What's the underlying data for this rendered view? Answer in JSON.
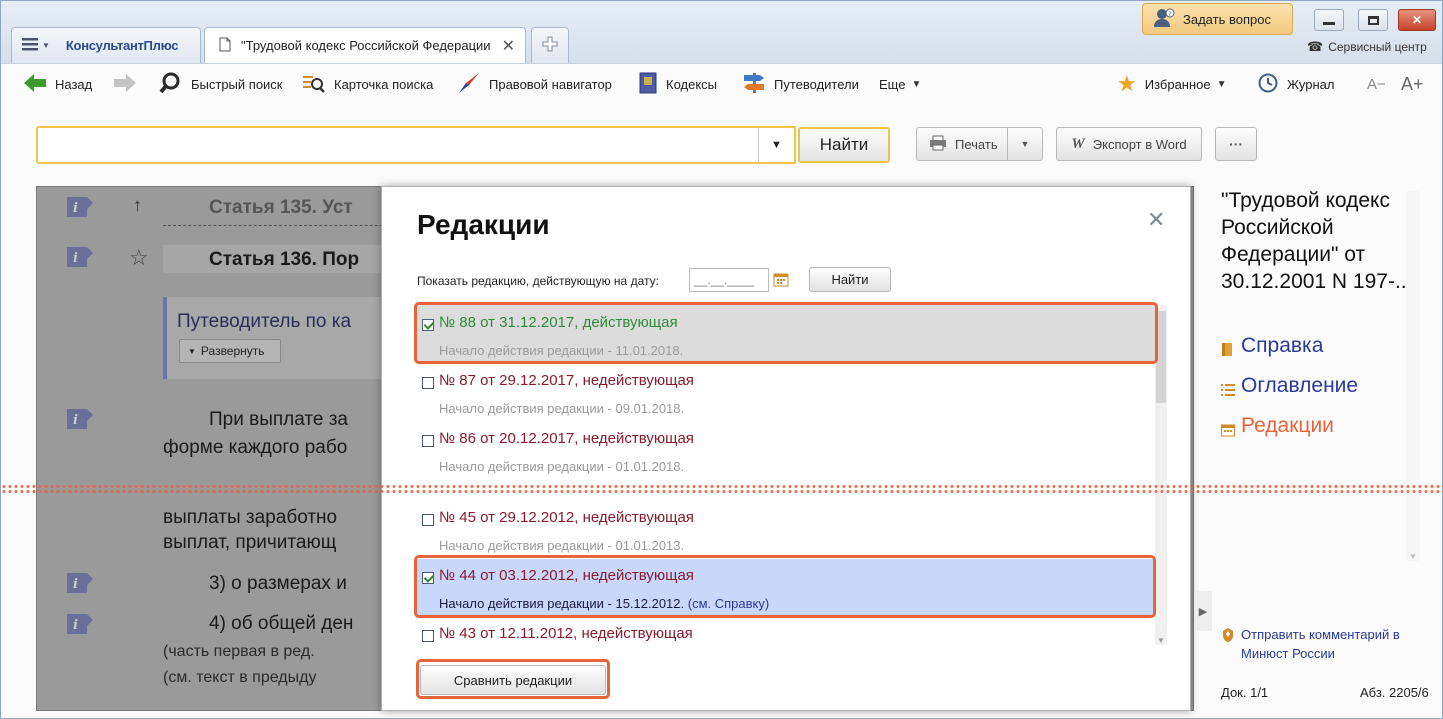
{
  "titlebar": {
    "menu_icon": "hamburger-icon",
    "app_tab_label": "КонсультантПлюс",
    "doc_tab_label": "\"Трудовой кодекс Российской Федерации",
    "ask_button": "Задать вопрос",
    "service_center": "Сервисный центр"
  },
  "toolbar": {
    "back": "Назад",
    "quick_search": "Быстрый поиск",
    "search_card": "Карточка поиска",
    "legal_navigator": "Правовой навигатор",
    "codes": "Кодексы",
    "guides": "Путеводители",
    "more": "Еще",
    "favorites": "Избранное",
    "journal": "Журнал",
    "font_smaller": "A−",
    "font_bigger": "A+"
  },
  "search": {
    "placeholder": "",
    "find_button": "Найти",
    "print_button": "Печать",
    "export_button": "Экспорт в Word",
    "more_button": "···"
  },
  "document": {
    "lines": [
      {
        "text": "Статья 135. Уст"
      },
      {
        "text": "Статья 136. Пор"
      },
      {
        "text": "Путеводитель по ка"
      },
      {
        "text": "Развернуть"
      },
      {
        "text": "При выплате за"
      },
      {
        "text": "форме каждого рабо"
      },
      {
        "text": "выплаты заработно"
      },
      {
        "text": "выплат, причитающ"
      },
      {
        "text": "3) о размерах и"
      },
      {
        "text": "4) об общей ден"
      },
      {
        "text": "(часть первая в ред."
      },
      {
        "text": "(см. текст в предыду"
      }
    ]
  },
  "dialog": {
    "title": "Редакции",
    "date_label": "Показать редакцию, действующую на дату:",
    "date_placeholder": "__.__.____",
    "find_button": "Найти",
    "compare_button": "Сравнить редакции",
    "items": [
      {
        "title": "№ 88 от 31.12.2017, действующая",
        "subtitle": "Начало действия редакции - 11.01.2018.",
        "link": "",
        "checked": true,
        "state": "current"
      },
      {
        "title": "№ 87 от 29.12.2017, недействующая",
        "subtitle": "Начало действия редакции - 09.01.2018.",
        "link": "",
        "checked": false,
        "state": "normal"
      },
      {
        "title": "№ 86 от 20.12.2017, недействующая",
        "subtitle": "Начало действия редакции - 01.01.2018.",
        "link": "",
        "checked": false,
        "state": "normal"
      },
      {
        "title": "№ 45 от 29.12.2012, недействующая",
        "subtitle": "Начало действия редакции - 01.01.2013.",
        "link": "",
        "checked": false,
        "state": "normal"
      },
      {
        "title": "№ 44 от 03.12.2012, недействующая",
        "subtitle": "Начало действия редакции - 15.12.2012.",
        "link": "(см. Справку)",
        "checked": true,
        "state": "selected"
      },
      {
        "title": "№ 43 от 12.11.2012, недействующая",
        "subtitle": "",
        "link": "",
        "checked": false,
        "state": "normal"
      }
    ]
  },
  "sidebar": {
    "doc_title": [
      "\"Трудовой кодекс",
      "Российской",
      "Федерации\" от",
      "30.12.2001 N 197-..."
    ],
    "links": [
      {
        "label": "Справка",
        "icon": "book-icon"
      },
      {
        "label": "Оглавление",
        "icon": "list-icon"
      },
      {
        "label": "Редакции",
        "icon": "calendar-icon"
      }
    ],
    "feedback": [
      "Отправить комментарий в",
      "Минюст России"
    ],
    "doc_counter": "Док. 1/1",
    "abs_counter": "Абз. 2205/6"
  },
  "colors": {
    "accent": "#e8633a",
    "current_green": "#2f8a3a",
    "inactive_red": "#8b1a2e",
    "selected_bg": "#c9d7fb",
    "link_blue": "#2a3a9a"
  }
}
